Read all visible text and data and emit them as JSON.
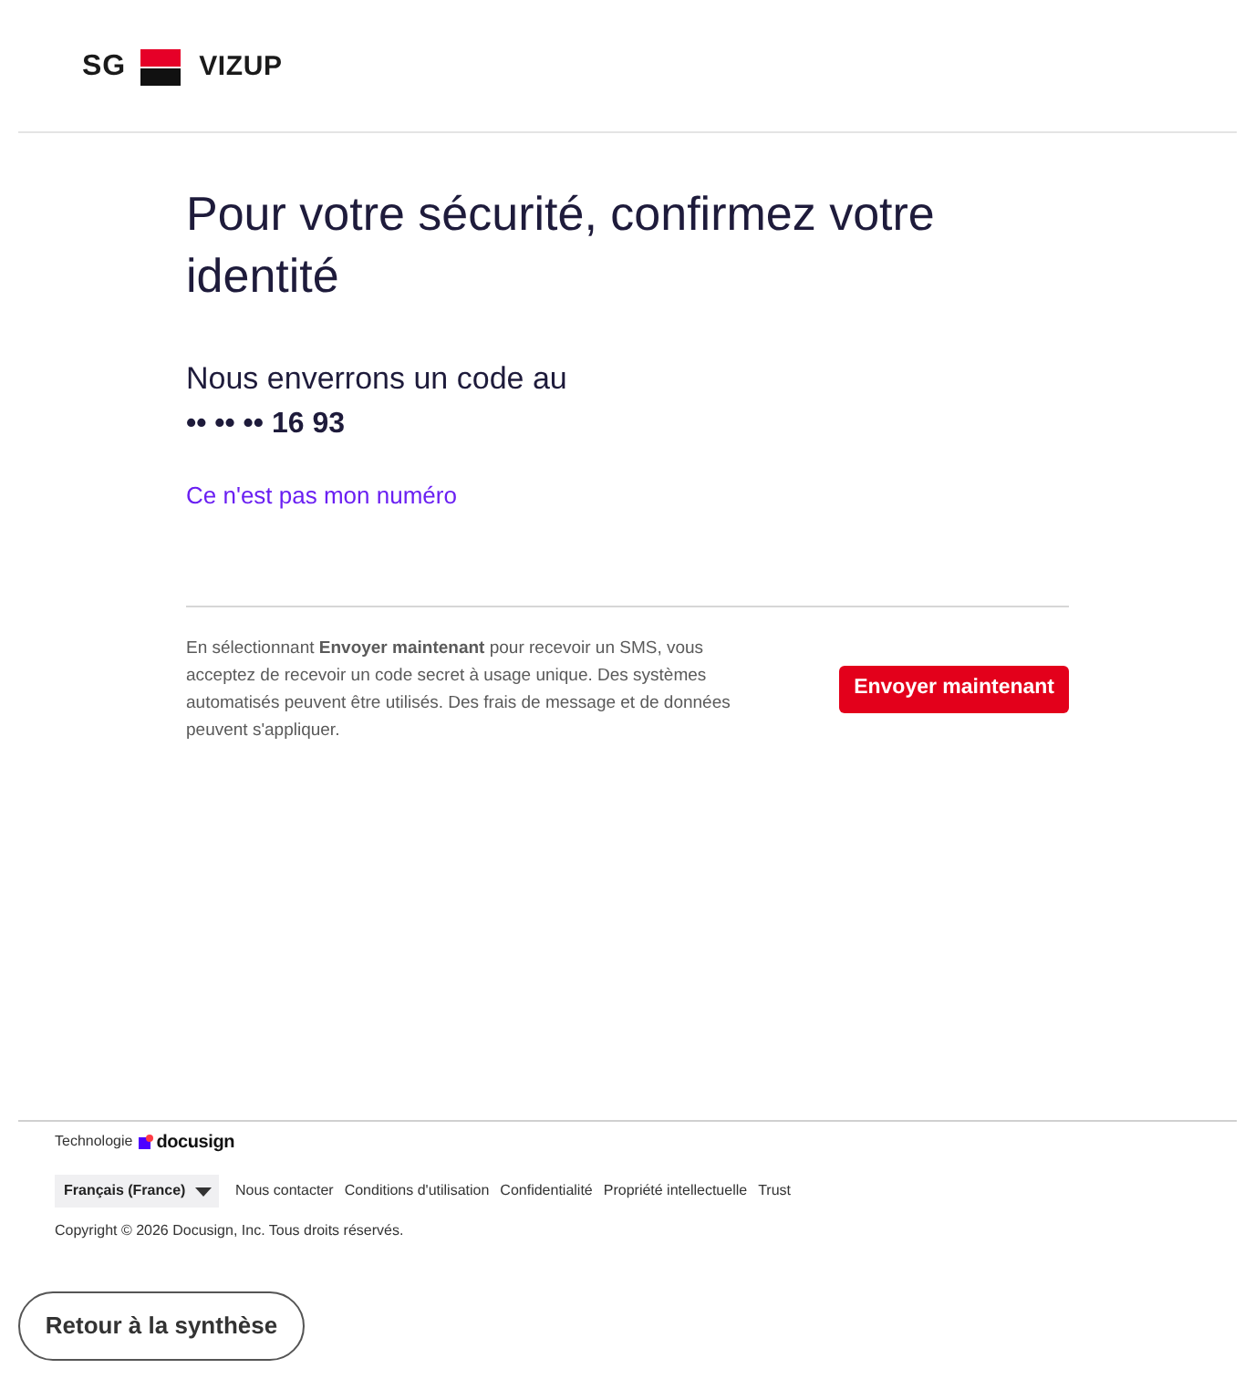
{
  "header": {
    "logo": {
      "left_text": "SG",
      "right_text": "VIZUP"
    }
  },
  "main": {
    "title": "Pour votre sécurité, confirmez votre identité",
    "message": "Nous enverrons un code au",
    "phone": "•• •• •• 16 93",
    "link": "Ce n'est pas mon numéro",
    "disclaimer": "En sélectionnant **Envoyer maintenant** pour recevoir un SMS, vous acceptez de recevoir un code secret à usage unique. Des systèmes automatisés peuvent être utilisés. Des frais de message et de données peuvent s'appliquer.",
    "send_button": "Envoyer maintenant"
  },
  "footer": {
    "powered_by": "Technologie",
    "brand": "docusign",
    "language": "Français (France)",
    "links": [
      "Nous contacter",
      "Conditions d'utilisation",
      "Confidentialité",
      "Propriété intellectuelle",
      "Trust"
    ],
    "copyright": "Copyright © 2026 Docusign, Inc. Tous droits réservés."
  },
  "back_button": "Retour à la synthèse"
}
